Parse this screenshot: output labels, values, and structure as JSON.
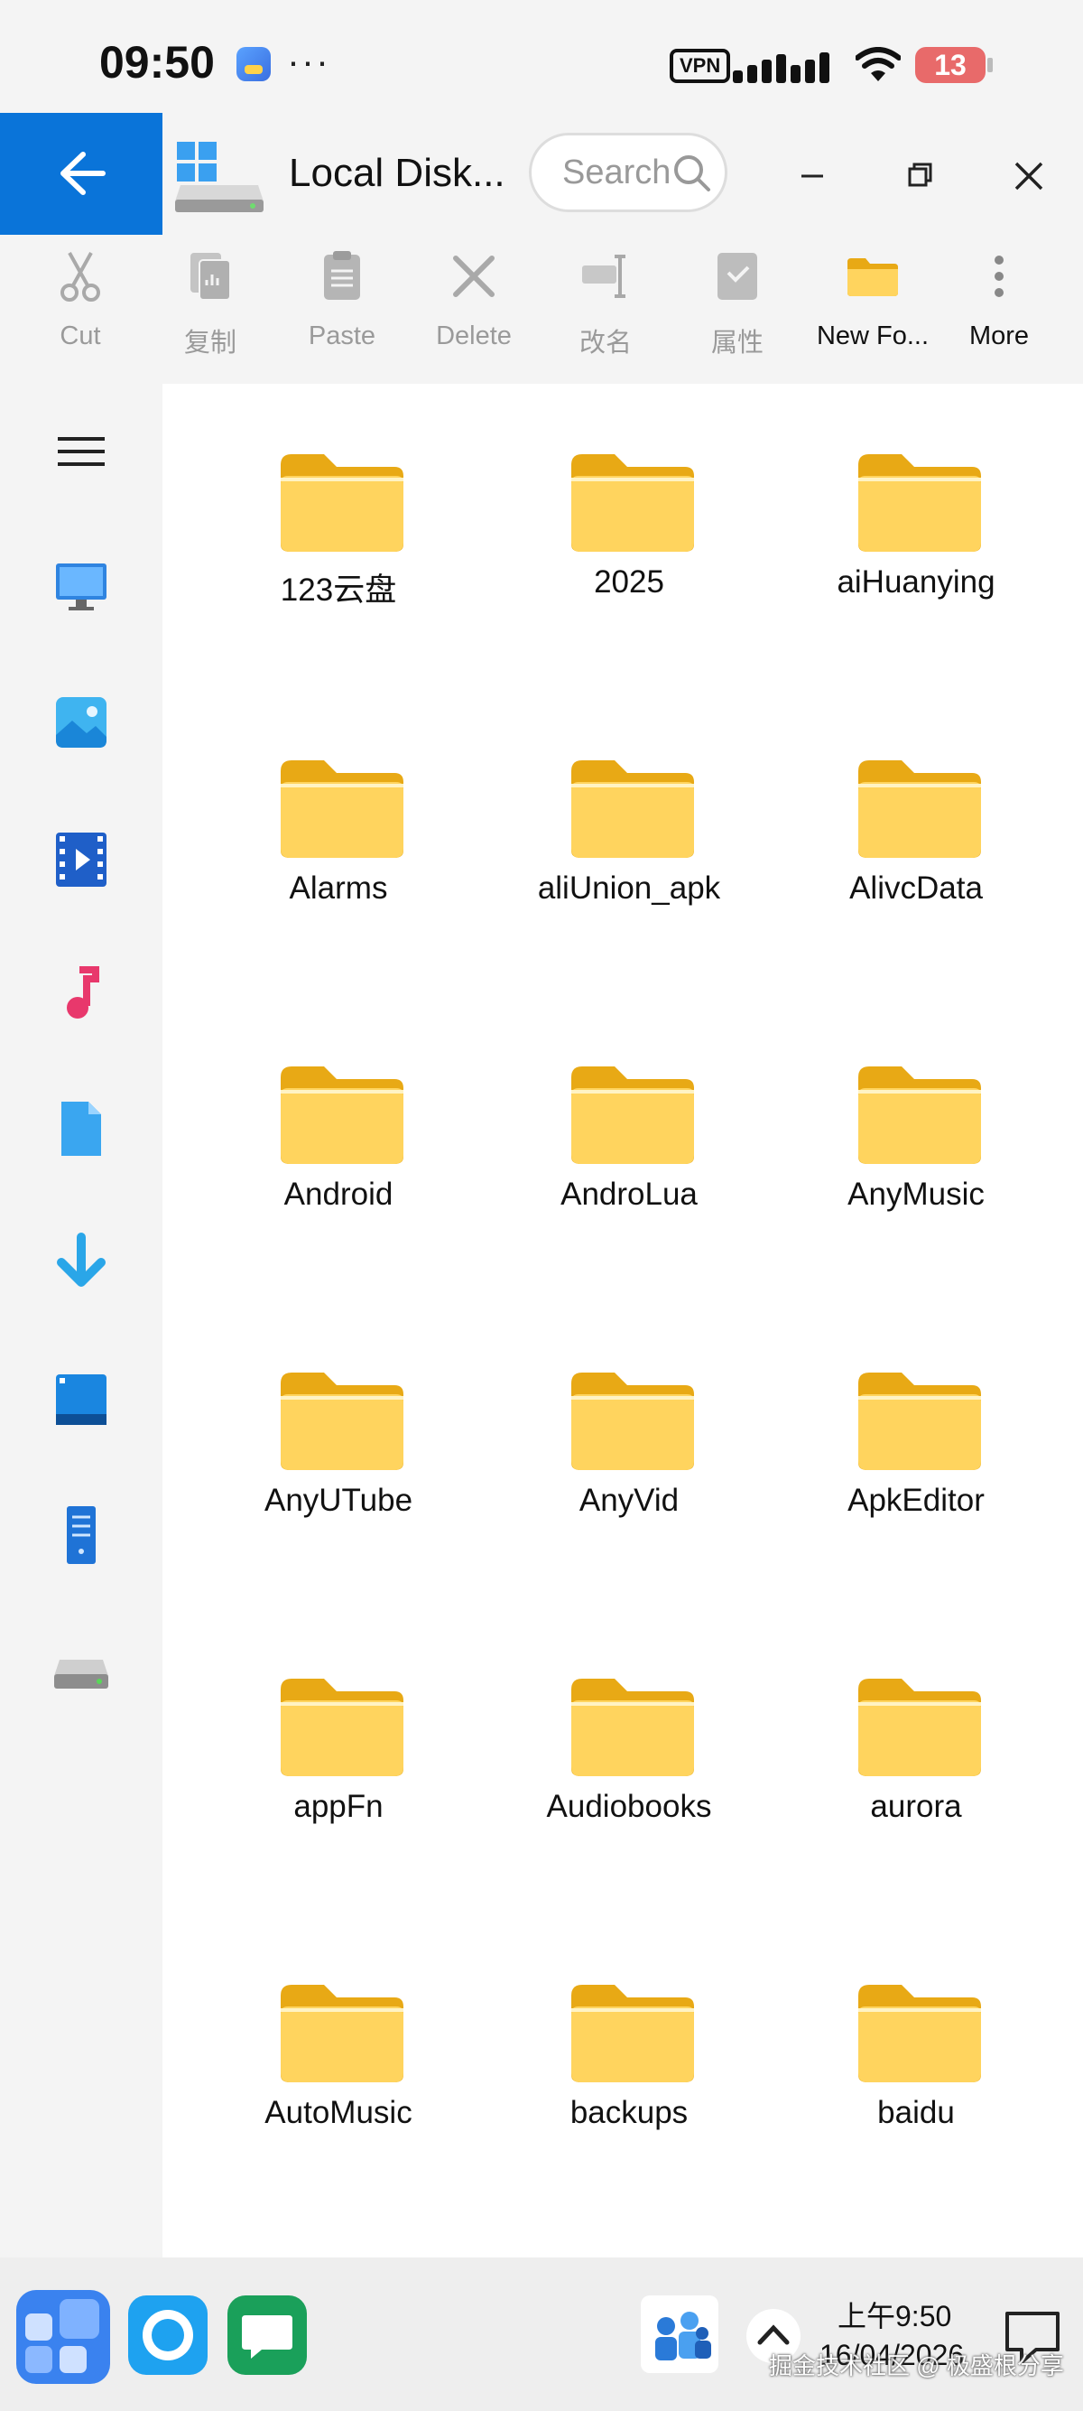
{
  "status": {
    "time": "09:50",
    "more": "···",
    "vpn": "VPN",
    "battery": "13"
  },
  "titlebar": {
    "title": "Local Disk...",
    "search_placeholder": "Search"
  },
  "toolbar": {
    "cut": "Cut",
    "copy": "复制",
    "paste": "Paste",
    "delete": "Delete",
    "rename": "改名",
    "properties": "属性",
    "new_folder": "New Fo...",
    "more": "More"
  },
  "folders": [
    "123云盘",
    "2025",
    "aiHuanying",
    "Alarms",
    "aliUnion_apk",
    "AlivcData",
    "Android",
    "AndroLua",
    "AnyMusic",
    "AnyUTube",
    "AnyVid",
    "ApkEditor",
    "appFn",
    "Audiobooks",
    "aurora",
    "AutoMusic",
    "backups",
    "baidu"
  ],
  "taskbar": {
    "clock_time": "上午9:50",
    "clock_date": "16/04/2026"
  },
  "watermark": "掘金技术社区 @ 极盛根分享",
  "colors": {
    "accent": "#0a74d9",
    "folder": "#ffd45e",
    "folder_tab": "#e8a915"
  }
}
